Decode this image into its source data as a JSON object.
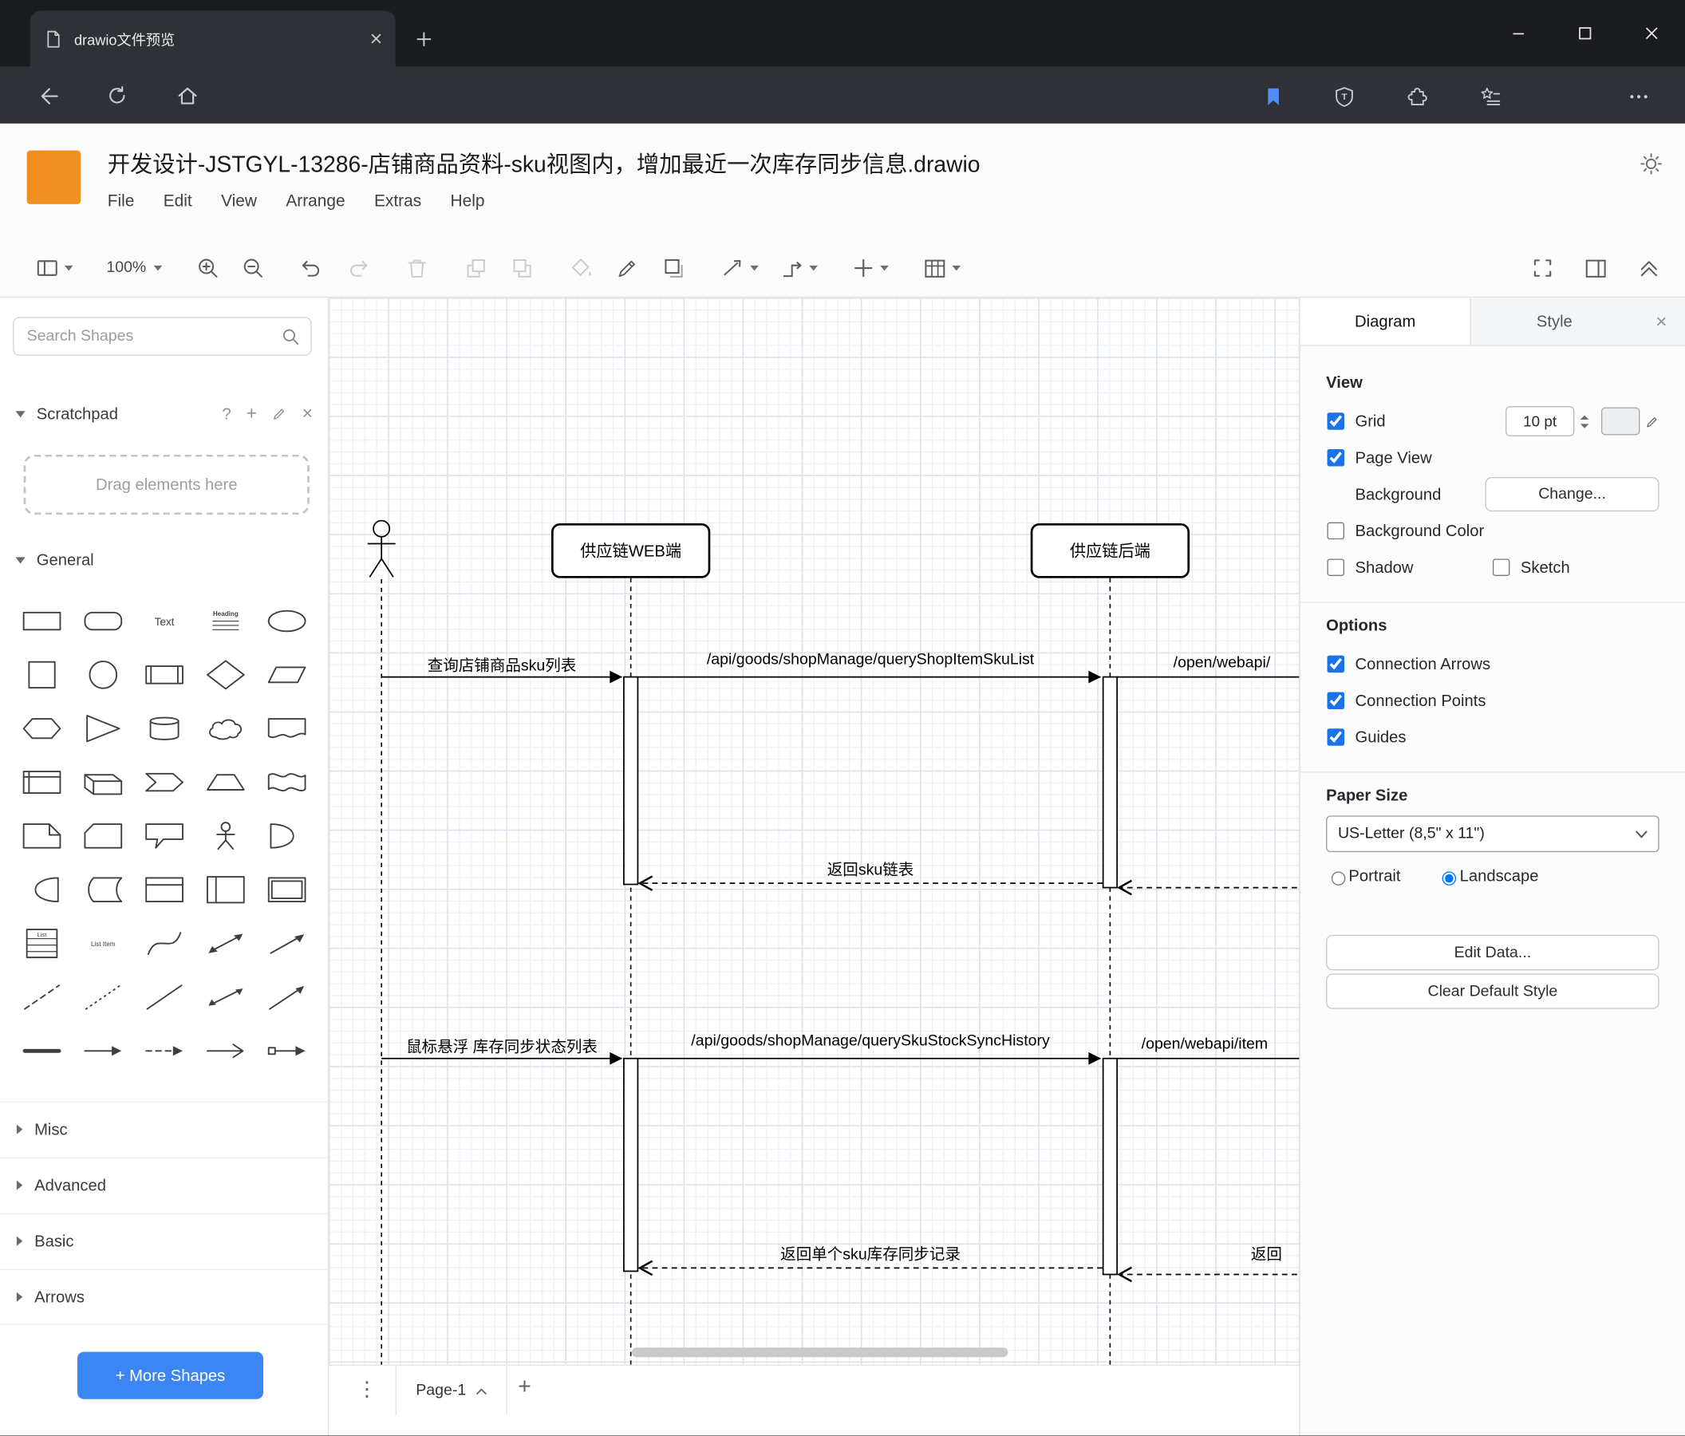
{
  "glyphs": {
    "question_mark": "?",
    "plus": "+",
    "close": "×",
    "vertical_dots": "⋮"
  },
  "browser": {
    "tab_title": "drawio文件预览",
    "url": "https://file.kkview.cn/onlinePreview?url=aHR0cHM6Ly9maWxlLmtrdmlldy5jbi..."
  },
  "header": {
    "title": "开发设计-JSTGYL-13286-店铺商品资料-sku视图内，增加最近一次库存同步信息.drawio",
    "menus": [
      "File",
      "Edit",
      "View",
      "Arrange",
      "Extras",
      "Help"
    ]
  },
  "toolbar": {
    "zoom": "100%"
  },
  "shapes": {
    "search_placeholder": "Search Shapes",
    "scratchpad_title": "Scratchpad",
    "scratchpad_hint": "Drag elements here",
    "general_title": "General",
    "sections": [
      "Misc",
      "Advanced",
      "Basic",
      "Arrows"
    ],
    "more_shapes": "+ More Shapes",
    "general_items": [
      "rectangle",
      "rounded-rectangle",
      "text",
      "heading",
      "ellipse",
      "square",
      "circle",
      "process",
      "diamond",
      "parallelogram",
      "hexagon",
      "triangle",
      "cylinder",
      "cloud",
      "document",
      "internal-storage",
      "cube",
      "step",
      "trapezoid",
      "tape",
      "note",
      "card",
      "callout",
      "actor",
      "or",
      "and",
      "data-storage",
      "container",
      "vertical-container",
      "horizontal-container",
      "list",
      "list-item",
      "curve",
      "bidirectional-arrow",
      "arrow",
      "dashed-line",
      "dotted-line",
      "line",
      "bidirectional-connector",
      "directional-connector",
      "bold-line",
      "arrow-edge",
      "dashed-arrow-edge",
      "open-arrow-edge",
      "box-arrow-edge"
    ]
  },
  "canvas": {
    "participants": [
      "供应链WEB端",
      "供应链后端"
    ],
    "messages": {
      "query_sku_list": "查询店铺商品sku列表",
      "api_query_shop_item_sku_list": "/api/goods/shopManage/queryShopItemSkuList",
      "open_webapi_1": "/open/webapi/",
      "return_sku_list": "返回sku链表",
      "hover_stock_sync": "鼠标悬浮 库存同步状态列表",
      "api_query_sku_stock_sync_history": "/api/goods/shopManage/querySkuStockSyncHistory",
      "open_webapi_2": "/open/webapi/item",
      "return_single_sku": "返回单个sku库存同步记录",
      "return_partial": "返回"
    },
    "page_tab": "Page-1"
  },
  "format": {
    "tabs": [
      "Diagram",
      "Style"
    ],
    "view_heading": "View",
    "grid_label": "Grid",
    "grid_size": "10 pt",
    "page_view_label": "Page View",
    "background_label": "Background",
    "change_button": "Change...",
    "background_color_label": "Background Color",
    "shadow_label": "Shadow",
    "sketch_label": "Sketch",
    "options_heading": "Options",
    "options": [
      "Connection Arrows",
      "Connection Points",
      "Guides"
    ],
    "paper_heading": "Paper Size",
    "paper_size_value": "US-Letter (8,5\" x 11\")",
    "portrait_label": "Portrait",
    "landscape_label": "Landscape",
    "edit_data_button": "Edit Data...",
    "clear_style_button": "Clear Default Style"
  },
  "states": {
    "grid": true,
    "page_view": true,
    "background_color": false,
    "shadow": false,
    "sketch": false,
    "connection_arrows": true,
    "connection_points": true,
    "guides": true,
    "portrait": false,
    "landscape": true
  }
}
